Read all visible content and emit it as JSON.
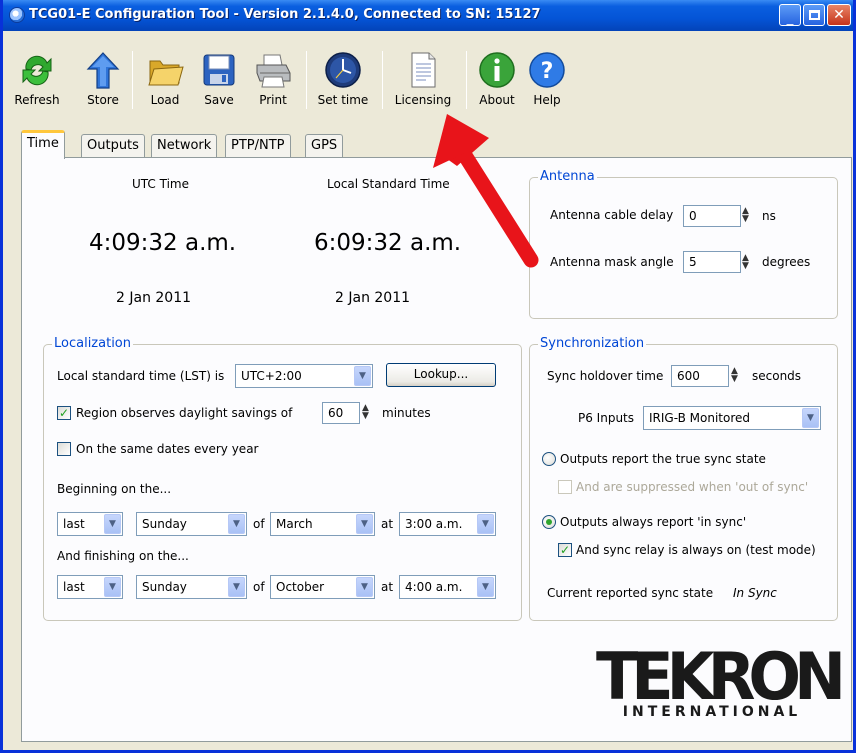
{
  "window": {
    "title": "TCG01-E Configuration Tool - Version 2.1.4.0, Connected to SN: 15127"
  },
  "toolbar": {
    "items": [
      {
        "label": "Refresh",
        "icon": "refresh-icon"
      },
      {
        "label": "Store",
        "icon": "store-arrow-icon"
      },
      {
        "label": "Load",
        "icon": "folder-icon"
      },
      {
        "label": "Save",
        "icon": "floppy-disk-icon"
      },
      {
        "label": "Print",
        "icon": "printer-icon"
      },
      {
        "label": "Set time",
        "icon": "clock-icon"
      },
      {
        "label": "Licensing",
        "icon": "document-icon"
      },
      {
        "label": "About",
        "icon": "info-icon"
      },
      {
        "label": "Help",
        "icon": "help-icon"
      }
    ]
  },
  "tabs": [
    "Time",
    "Outputs",
    "Network",
    "PTP/NTP",
    "GPS"
  ],
  "time": {
    "utc_label": "UTC Time",
    "local_label": "Local Standard Time",
    "utc_time": "4:09:32 a.m.",
    "local_time": "6:09:32 a.m.",
    "utc_date": "2 Jan 2011",
    "local_date": "2 Jan 2011"
  },
  "antenna": {
    "title": "Antenna",
    "cable_delay_label": "Antenna cable delay",
    "cable_delay_value": "0",
    "cable_delay_unit": "ns",
    "mask_angle_label": "Antenna mask angle",
    "mask_angle_value": "5",
    "mask_angle_unit": "degrees"
  },
  "localization": {
    "title": "Localization",
    "lst_label": "Local standard time (LST) is",
    "lst_value": "UTC+2:00",
    "lookup_button": "Lookup...",
    "dst_label": "Region observes daylight savings of",
    "dst_checked": true,
    "dst_minutes": "60",
    "dst_unit": "minutes",
    "same_dates_label": "On the same dates every year",
    "same_dates_checked": false,
    "beginning_label": "Beginning on the...",
    "begin": {
      "week": "last",
      "day": "Sunday",
      "of": "of",
      "month": "March",
      "at": "at",
      "time": "3:00 a.m."
    },
    "finishing_label": "And finishing on the...",
    "finish": {
      "week": "last",
      "day": "Sunday",
      "of": "of",
      "month": "October",
      "at": "at",
      "time": "4:00 a.m."
    }
  },
  "sync": {
    "title": "Synchronization",
    "holdover_label": "Sync holdover time",
    "holdover_value": "600",
    "holdover_unit": "seconds",
    "p6_label": "P6 Inputs",
    "p6_value": "IRIG-B Monitored",
    "radio_true_label": "Outputs report the true sync state",
    "suppressed_label": "And are suppressed when 'out of sync'",
    "radio_always_label": "Outputs always report 'in sync'",
    "relay_label": "And sync relay is always on (test mode)",
    "relay_checked": true,
    "current_label": "Current reported sync state",
    "current_value": "In Sync"
  },
  "logo": {
    "brand": "TEKRON",
    "sub": "INTERNATIONAL"
  },
  "colors": {
    "titlebar": "#0454d6",
    "group_title": "#0046d5",
    "annotation_arrow": "#e8141a",
    "tab_highlight": "#ffc73c"
  }
}
